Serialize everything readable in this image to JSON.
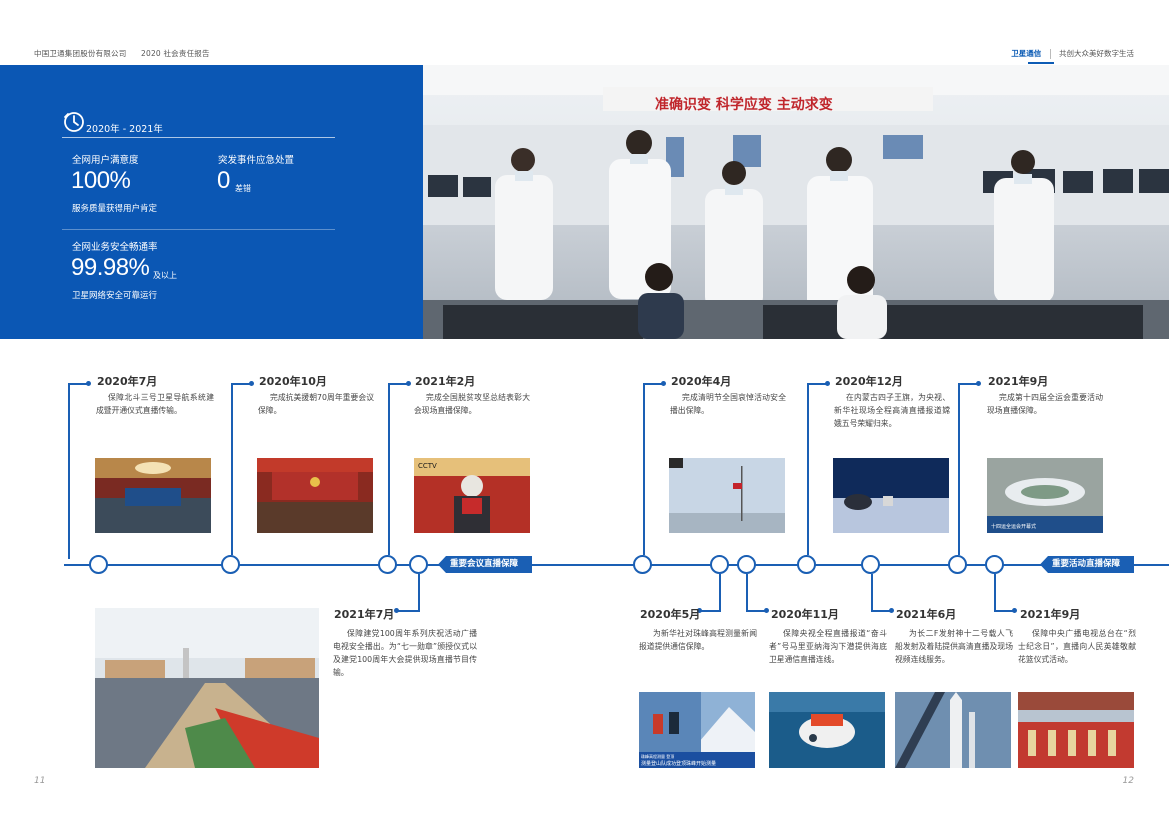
{
  "header": {
    "company": "中国卫通集团股份有限公司",
    "report": "2020 社会责任报告",
    "brand": "卫星通信",
    "slogan": "共创大众美好数字生活"
  },
  "stats": {
    "period": "2020年 - 2021年",
    "satisfaction_label": "全网用户满意度",
    "satisfaction_value": "100%",
    "satisfaction_sub": "服务质量获得用户肯定",
    "emergency_label": "突发事件应急处置",
    "emergency_value": "0",
    "emergency_unit": "差错",
    "security_label": "全网业务安全畅通率",
    "security_value": "99.98%",
    "security_unit": "及以上",
    "security_sub": "卫星网络安全可靠运行"
  },
  "photo": {
    "banner_text": "准确识变  科学应变  主动求变"
  },
  "banners": {
    "meeting": "重要会议直播保障",
    "activity": "重要活动直播保障"
  },
  "events_top": [
    {
      "date": "2020年7月",
      "desc": "保障北斗三号卫星导航系统建成暨开通仪式直播传输。"
    },
    {
      "date": "2020年10月",
      "desc": "完成抗美援朝70周年重要会议保障。"
    },
    {
      "date": "2021年2月",
      "desc": "完成全国脱贫攻坚总结表彰大会现场直播保障。"
    },
    {
      "date": "2020年4月",
      "desc": "完成清明节全国哀悼活动安全播出保障。"
    },
    {
      "date": "2020年12月",
      "desc": "在内蒙古四子王旗，为央视、新华社现场全程高清直播报道嫦娥五号荣耀归来。"
    },
    {
      "date": "2021年9月",
      "desc": "完成第十四届全运会重要活动现场直播保障。"
    }
  ],
  "events_bottom": [
    {
      "date": "2021年7月",
      "desc": "保障建党100周年系列庆祝活动广播电视安全播出。为“七一勋章”颁授仪式以及建党100周年大会提供现场直播节目传输。"
    },
    {
      "date": "2020年5月",
      "desc": "为新华社对珠峰高程测量新闻报道提供通信保障。"
    },
    {
      "date": "2020年11月",
      "desc": "保障央视全程直播报道“奋斗者”号马里亚纳海沟下潜提供海底卫星通信直播连线。"
    },
    {
      "date": "2021年6月",
      "desc": "为长二F发射神十二号载人飞船发射及着陆提供高清直播及现场视频连线服务。"
    },
    {
      "date": "2021年9月",
      "desc": "保障中央广播电视总台在“烈士纪念日”，直播向人民英雄敬献花篮仪式活动。"
    }
  ],
  "captions": {
    "cctv_logo": "CCTV",
    "games_caption": "十四运全运会开幕式",
    "everest_caption": "珠峰高程测量 登顶",
    "everest_strip": "测量登山队成功登顶珠峰开始测量"
  },
  "page_numbers": {
    "left": "11",
    "right": "12"
  }
}
